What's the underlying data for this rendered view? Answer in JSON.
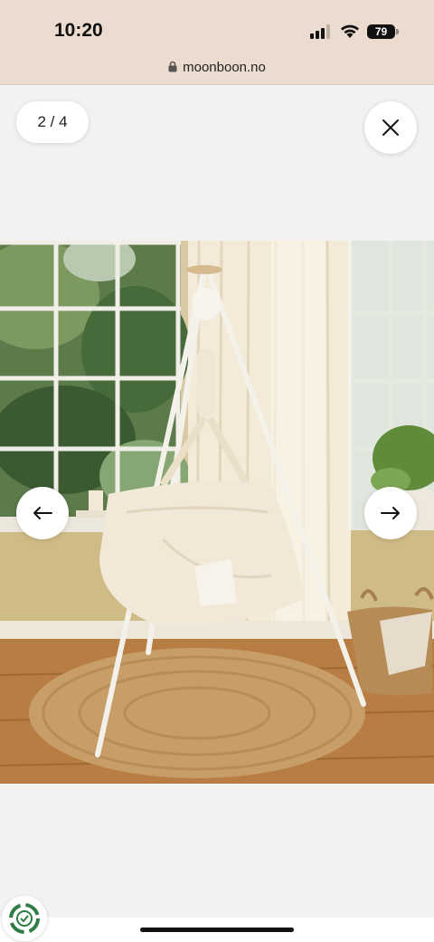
{
  "status_bar": {
    "time": "10:20",
    "battery": "79"
  },
  "browser": {
    "url": "moonboon.no"
  },
  "gallery": {
    "counter": "2 / 4"
  },
  "colors": {
    "status_bar_bg": "#ebdccf",
    "page_bg": "#f4f2f1"
  },
  "icons": {
    "signal": "signal-icon",
    "wifi": "wifi-icon",
    "lock": "lock-icon",
    "close": "close-icon",
    "prev": "arrow-left-icon",
    "next": "arrow-right-icon",
    "badge": "recycle-badge-icon"
  }
}
